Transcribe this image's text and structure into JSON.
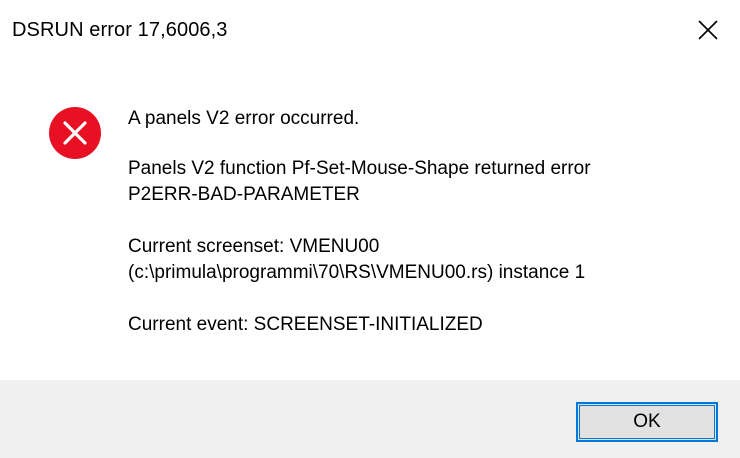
{
  "window": {
    "title": "DSRUN error 17,6006,3",
    "close_icon": "close-icon"
  },
  "icon": {
    "type": "error-icon",
    "color": "#e81123"
  },
  "message": {
    "line1": "A panels V2 error occurred.",
    "line2a": "Panels V2 function Pf-Set-Mouse-Shape returned error",
    "line2b": "P2ERR-BAD-PARAMETER",
    "line3a": "Current screenset: VMENU00",
    "line3b": "(c:\\primula\\programmi\\70\\RS\\VMENU00.rs) instance 1",
    "line4": "Current event: SCREENSET-INITIALIZED"
  },
  "buttons": {
    "ok_label": "OK"
  },
  "colors": {
    "accent": "#0078d7",
    "footer_bg": "#f0f0f0"
  }
}
